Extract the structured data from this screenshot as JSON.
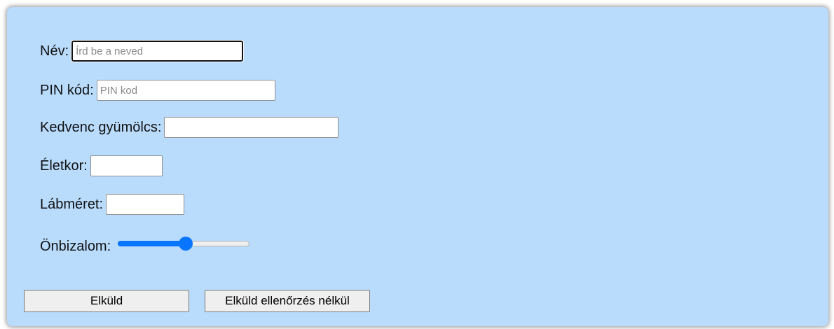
{
  "form": {
    "name": {
      "label": "Név:",
      "placeholder": "Írd be a neved",
      "value": ""
    },
    "pin": {
      "label": "PIN kód:",
      "placeholder": "PIN kod",
      "value": ""
    },
    "fruit": {
      "label": "Kedvenc gyümölcs:",
      "value": ""
    },
    "age": {
      "label": "Életkor:",
      "value": ""
    },
    "shoe": {
      "label": "Lábméret:",
      "value": ""
    },
    "confidence": {
      "label": "Önbizalom:",
      "value_fraction": 0.52
    },
    "submit_label": "Elküld",
    "submit_novalidate_label": "Elküld ellenőrzés nélkül"
  },
  "colors": {
    "panel_background": "#b9dcfd",
    "slider_accent": "#0a75ff"
  }
}
